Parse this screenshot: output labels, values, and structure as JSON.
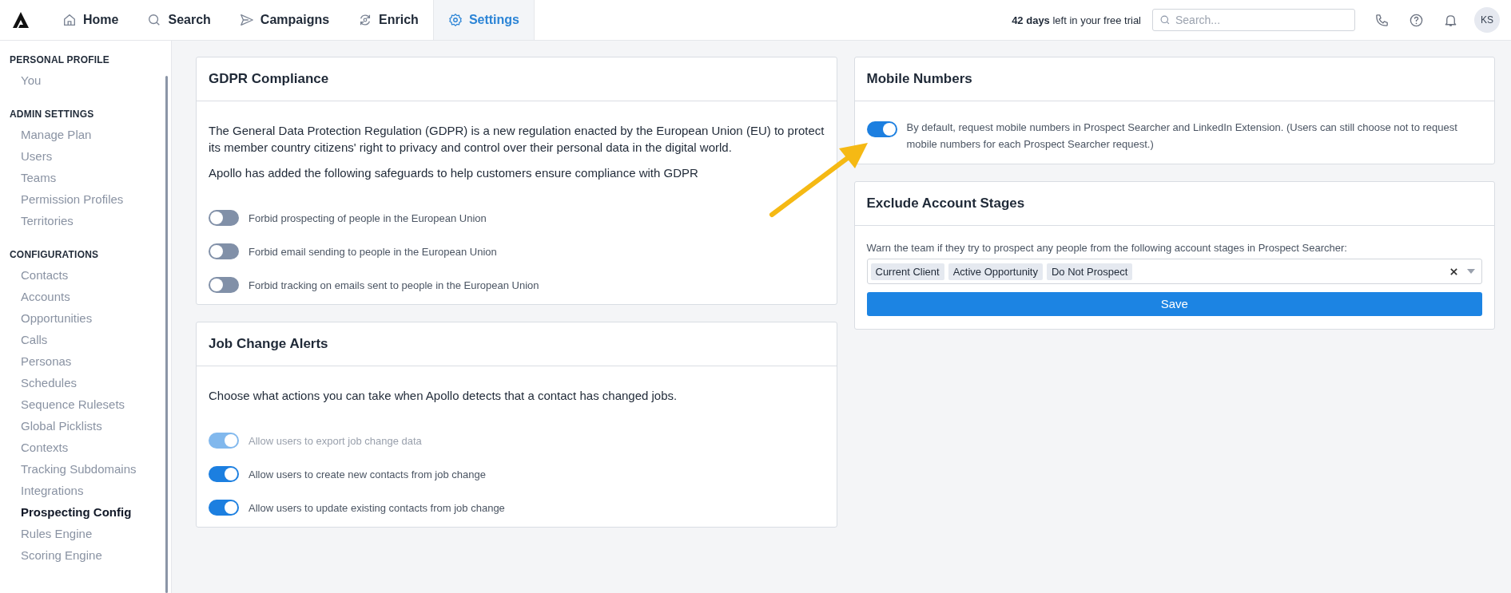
{
  "nav": {
    "tabs": [
      {
        "label": "Home",
        "selected": false
      },
      {
        "label": "Search",
        "selected": false
      },
      {
        "label": "Campaigns",
        "selected": false
      },
      {
        "label": "Enrich",
        "selected": false
      },
      {
        "label": "Settings",
        "selected": true
      }
    ],
    "trial": "**42 days** left in your free trial",
    "search": {
      "placeholder": "Search..."
    },
    "avatar": "KS"
  },
  "sidebar": {
    "sections": [
      {
        "heading": "PERSONAL PROFILE",
        "items": [
          {
            "label": "You",
            "selected": false
          }
        ]
      },
      {
        "heading": "ADMIN SETTINGS",
        "items": [
          {
            "label": "Manage Plan",
            "selected": false
          },
          {
            "label": "Users",
            "selected": false
          },
          {
            "label": "Teams",
            "selected": false
          },
          {
            "label": "Permission Profiles",
            "selected": false
          },
          {
            "label": "Territories",
            "selected": false
          }
        ]
      },
      {
        "heading": "CONFIGURATIONS",
        "items": [
          {
            "label": "Contacts",
            "selected": false
          },
          {
            "label": "Accounts",
            "selected": false
          },
          {
            "label": "Opportunities",
            "selected": false
          },
          {
            "label": "Calls",
            "selected": false
          },
          {
            "label": "Personas",
            "selected": false
          },
          {
            "label": "Schedules",
            "selected": false
          },
          {
            "label": "Sequence Rulesets",
            "selected": false
          },
          {
            "label": "Global Picklists",
            "selected": false
          },
          {
            "label": "Contexts",
            "selected": false
          },
          {
            "label": "Tracking Subdomains",
            "selected": false
          },
          {
            "label": "Integrations",
            "selected": false
          },
          {
            "label": "Prospecting Config",
            "selected": true
          },
          {
            "label": "Rules Engine",
            "selected": false
          },
          {
            "label": "Scoring Engine",
            "selected": false
          }
        ]
      }
    ]
  },
  "gdpr": {
    "title": "GDPR Compliance",
    "paragraphs": [
      "The General Data Protection Regulation (GDPR) is a new regulation enacted by the European Union (EU) to protect its member country citizens' right to privacy and control over their personal data in the digital world.",
      "Apollo has added the following safeguards to help customers ensure compliance with GDPR"
    ],
    "toggles": [
      {
        "label": "Forbid prospecting of people in the European Union",
        "on": false,
        "disabled": false
      },
      {
        "label": "Forbid email sending to people in the European Union",
        "on": false,
        "disabled": false
      },
      {
        "label": "Forbid tracking on emails sent to people in the European Union",
        "on": false,
        "disabled": false
      }
    ]
  },
  "job_change": {
    "title": "Job Change Alerts",
    "description": "Choose what actions you can take when Apollo detects that a contact has changed jobs.",
    "toggles": [
      {
        "label": "Allow users to export job change data",
        "on": true,
        "disabled": true
      },
      {
        "label": "Allow users to create new contacts from job change",
        "on": true,
        "disabled": false
      },
      {
        "label": "Allow users to update existing contacts from job change",
        "on": true,
        "disabled": false
      }
    ]
  },
  "mobile": {
    "title": "Mobile Numbers",
    "toggle": {
      "label": "By default, request mobile numbers in Prospect Searcher and LinkedIn Extension. (Users can still choose not to request mobile numbers for each Prospect Searcher request.)",
      "on": true,
      "disabled": false
    }
  },
  "exclude": {
    "title": "Exclude Account Stages",
    "description": "Warn the team if they try to prospect any people from the following account stages in Prospect Searcher:",
    "tags": [
      "Current Client",
      "Active Opportunity",
      "Do Not Prospect"
    ],
    "button": "Save"
  }
}
